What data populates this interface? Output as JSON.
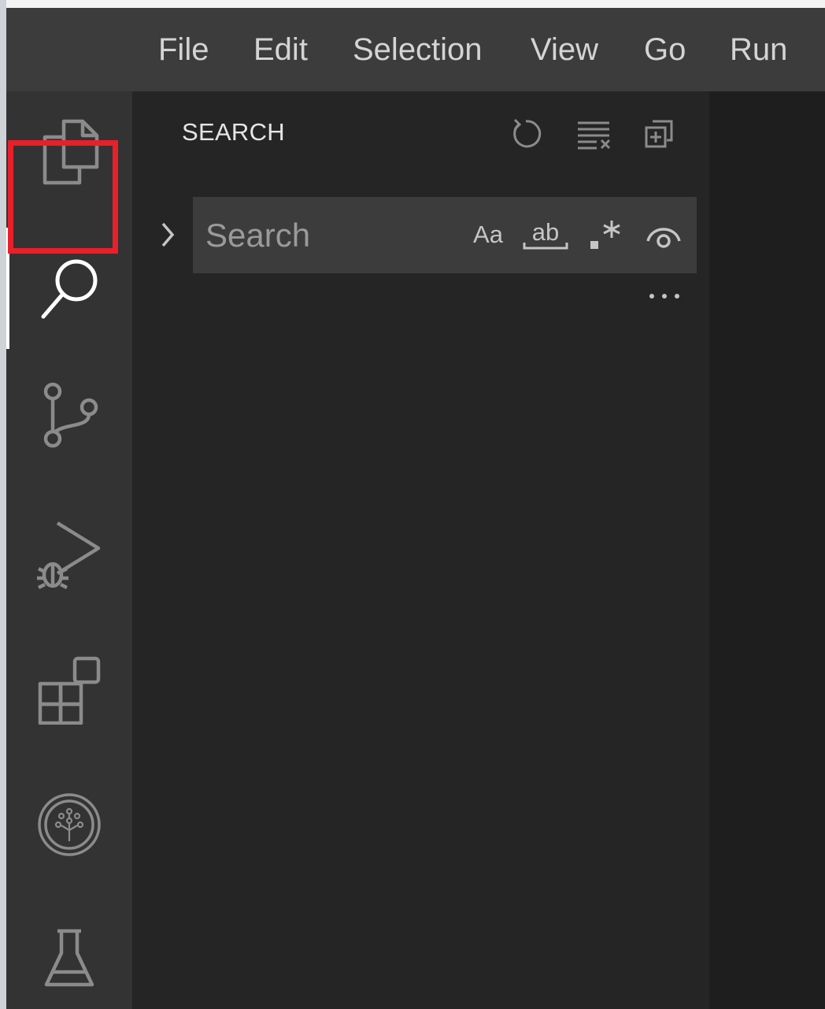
{
  "menubar": {
    "items": [
      "File",
      "Edit",
      "Selection",
      "View",
      "Go",
      "Run"
    ]
  },
  "activity_bar": {
    "items": [
      {
        "name": "explorer",
        "icon": "files-icon",
        "active": false
      },
      {
        "name": "search",
        "icon": "search-icon",
        "active": true
      },
      {
        "name": "source-control",
        "icon": "source-control-icon",
        "active": false
      },
      {
        "name": "run-and-debug",
        "icon": "run-debug-icon",
        "active": false
      },
      {
        "name": "extensions",
        "icon": "extensions-icon",
        "active": false
      },
      {
        "name": "tree-extension",
        "icon": "tree-circle-icon",
        "active": false
      },
      {
        "name": "testing",
        "icon": "beaker-icon",
        "active": false
      }
    ]
  },
  "sidebar": {
    "title": "SEARCH",
    "actions": [
      "refresh-icon",
      "clear-results-icon",
      "collapse-all-icon"
    ],
    "search": {
      "placeholder": "Search",
      "value": "",
      "options": {
        "match_case": "Aa",
        "match_whole_word": "ab",
        "regex": ".*"
      }
    },
    "more_label": "..."
  },
  "colors": {
    "menubar_bg": "#3c3c3c",
    "activitybar_bg": "#333333",
    "sidebar_bg": "#252526",
    "editor_bg": "#1e1e1e",
    "highlight": "#e8202a",
    "text": "#cccccc"
  }
}
